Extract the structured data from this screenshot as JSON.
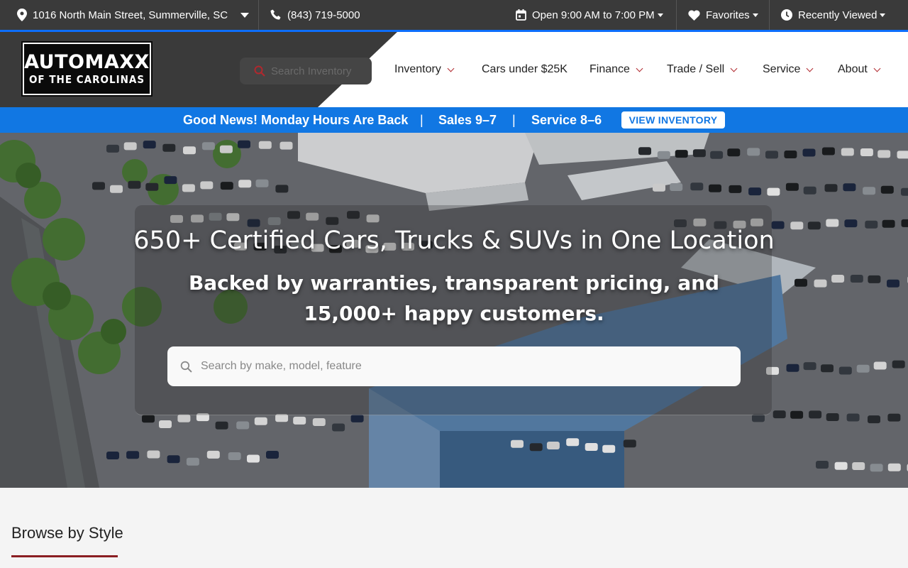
{
  "topbar": {
    "address": "1016 North Main Street, Summerville, SC",
    "phone": "(843) 719-5000",
    "hours": "Open 9:00 AM to 7:00 PM",
    "favorites": "Favorites",
    "recently_viewed": "Recently Viewed"
  },
  "header": {
    "logo_line1": "AUTOMAXX",
    "logo_line2": "OF THE CAROLINAS",
    "search_placeholder": "Search Inventory",
    "nav": [
      {
        "label": "Inventory"
      },
      {
        "label": "Cars under $25K"
      },
      {
        "label": "Finance"
      },
      {
        "label": "Trade / Sell"
      },
      {
        "label": "Service"
      },
      {
        "label": "About"
      }
    ]
  },
  "promo": {
    "news": "Good News! Monday Hours Are Back",
    "divider": "|",
    "sales": "Sales 9–7",
    "service": "Service 8–6",
    "button": "VIEW INVENTORY"
  },
  "hero": {
    "title": "650+ Certified Cars, Trucks & SUVs in One Location",
    "subtitle": "Backed by warranties, transparent pricing, and 15,000+ happy customers.",
    "search_placeholder": "Search by make, model, feature"
  },
  "browse": {
    "heading": "Browse by Style"
  },
  "colors": {
    "topbar_bg": "#3a3a3a",
    "promo_blue": "#1177e3",
    "accent_red": "#b0282e",
    "underline_red": "#8a1e22"
  }
}
